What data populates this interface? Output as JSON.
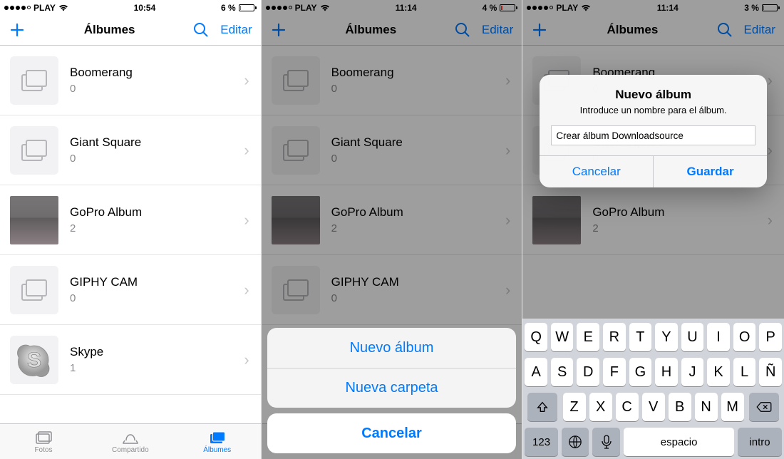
{
  "carrier": "PLAY",
  "screen1": {
    "time": "10:54",
    "battery_pct": "6 %"
  },
  "screen2": {
    "time": "11:14",
    "battery_pct": "4 %"
  },
  "screen3": {
    "time": "11:14",
    "battery_pct": "3 %"
  },
  "nav": {
    "title": "Álbumes",
    "edit": "Editar"
  },
  "albums": [
    {
      "name": "Boomerang",
      "count": "0",
      "thumb": "stack"
    },
    {
      "name": "Giant Square",
      "count": "0",
      "thumb": "stack"
    },
    {
      "name": "GoPro Album",
      "count": "2",
      "thumb": "photo"
    },
    {
      "name": "GIPHY CAM",
      "count": "0",
      "thumb": "stack"
    },
    {
      "name": "Skype",
      "count": "1",
      "thumb": "skype"
    }
  ],
  "tabs": {
    "photos": "Fotos",
    "shared": "Compartido",
    "albums": "Álbumes"
  },
  "sheet": {
    "new_album": "Nuevo álbum",
    "new_folder": "Nueva carpeta",
    "cancel": "Cancelar"
  },
  "alert": {
    "title": "Nuevo álbum",
    "message": "Introduce un nombre para el álbum.",
    "input_value": "Crear álbum Downloadsource",
    "cancel": "Cancelar",
    "save": "Guardar"
  },
  "keyboard": {
    "r1": [
      "Q",
      "W",
      "E",
      "R",
      "T",
      "Y",
      "U",
      "I",
      "O",
      "P"
    ],
    "r2": [
      "A",
      "S",
      "D",
      "F",
      "G",
      "H",
      "J",
      "K",
      "L",
      "Ñ"
    ],
    "r3": [
      "Z",
      "X",
      "C",
      "V",
      "B",
      "N",
      "M"
    ],
    "num": "123",
    "space": "espacio",
    "return": "intro"
  }
}
